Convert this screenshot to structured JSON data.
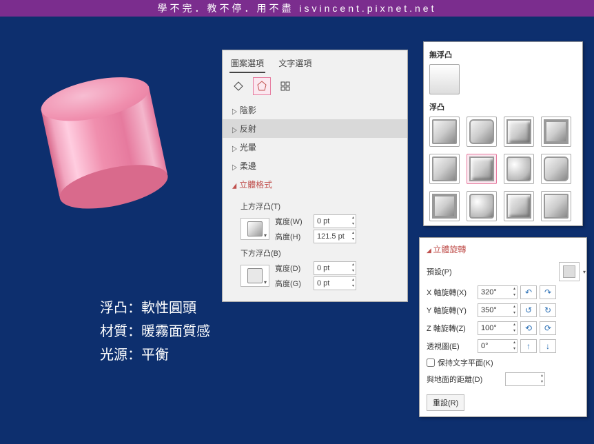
{
  "titlebar": "學不完．教不停．用不盡 isvincent.pixnet.net",
  "format_panel": {
    "tab_pattern": "圖案選項",
    "tab_text": "文字選項",
    "sections": {
      "shadow": "陰影",
      "reflection": "反射",
      "glow": "光暈",
      "softedge": "柔邊",
      "format3d": "立體格式"
    },
    "top_bevel_label": "上方浮凸(T)",
    "bottom_bevel_label": "下方浮凸(B)",
    "width_label": "寬度(W)",
    "height_label": "高度(H)",
    "depth_label": "寬度(D)",
    "height_g_label": "高度(G)",
    "top_width_value": "0 pt",
    "top_height_value": "121.5 pt",
    "bottom_width_value": "0 pt",
    "bottom_height_value": "0 pt"
  },
  "bevel_palette": {
    "none_header": "無浮凸",
    "bevel_header": "浮凸"
  },
  "rotation_panel": {
    "title": "立體旋轉",
    "preset_label": "預設(P)",
    "x_label": "X 軸旋轉(X)",
    "y_label": "Y 軸旋轉(Y)",
    "z_label": "Z 軸旋轉(Z)",
    "perspective_label": "透視圖(E)",
    "x_value": "320°",
    "y_value": "350°",
    "z_value": "100°",
    "perspective_value": "0°",
    "keep_flat_label": "保持文字平面(K)",
    "distance_label": "與地面的距離(D)",
    "distance_value": "",
    "reset_label": "重設(R)"
  },
  "annotations": {
    "line1": "浮凸：軟性圓頭",
    "line2": "材質：暖霧面質感",
    "line3": "光源：平衡"
  }
}
